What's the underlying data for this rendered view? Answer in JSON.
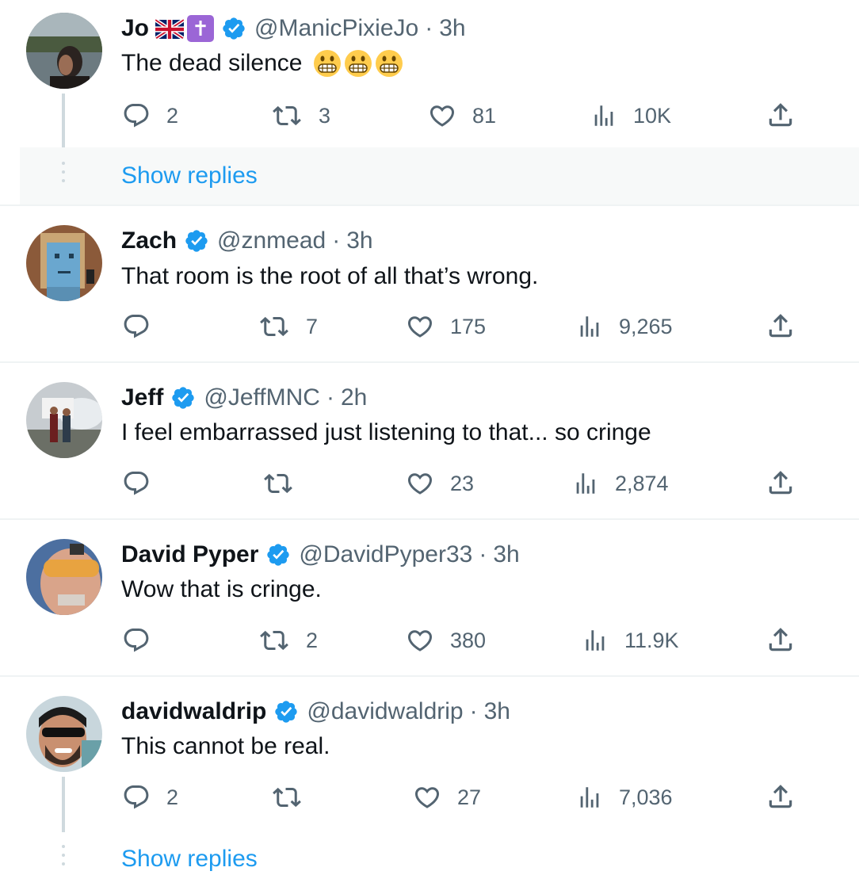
{
  "tweets": [
    {
      "name": "Jo",
      "handle": "@ManicPixieJo",
      "time": "3h",
      "text": "The dead silence",
      "emoji": "grimacing-face",
      "replies": "2",
      "retweets": "3",
      "likes": "81",
      "views": "10K",
      "show_replies": "Show replies"
    },
    {
      "name": "Zach",
      "handle": "@znmead",
      "time": "3h",
      "text": "That room is the root of all that’s wrong.",
      "replies": "",
      "retweets": "7",
      "likes": "175",
      "views": "9,265"
    },
    {
      "name": "Jeff",
      "handle": "@JeffMNC",
      "time": "2h",
      "text": "I feel embarrassed just listening to that... so cringe",
      "replies": "",
      "retweets": "",
      "likes": "23",
      "views": "2,874"
    },
    {
      "name": "David Pyper",
      "handle": "@DavidPyper33",
      "time": "3h",
      "text": "Wow that is cringe.",
      "replies": "",
      "retweets": "2",
      "likes": "380",
      "views": "11.9K"
    },
    {
      "name": "davidwaldrip",
      "handle": "@davidwaldrip",
      "time": "3h",
      "text": "This cannot be real.",
      "replies": "2",
      "retweets": "",
      "likes": "27",
      "views": "7,036",
      "show_replies": "Show replies"
    }
  ],
  "separator": "·",
  "icons": [
    "reply-icon",
    "retweet-icon",
    "like-icon",
    "views-icon",
    "share-icon",
    "verified-badge-icon"
  ],
  "colors": {
    "accent": "#1d9bf0",
    "muted": "#536471",
    "text": "#0f1419",
    "verified": "#1d9bf0"
  }
}
